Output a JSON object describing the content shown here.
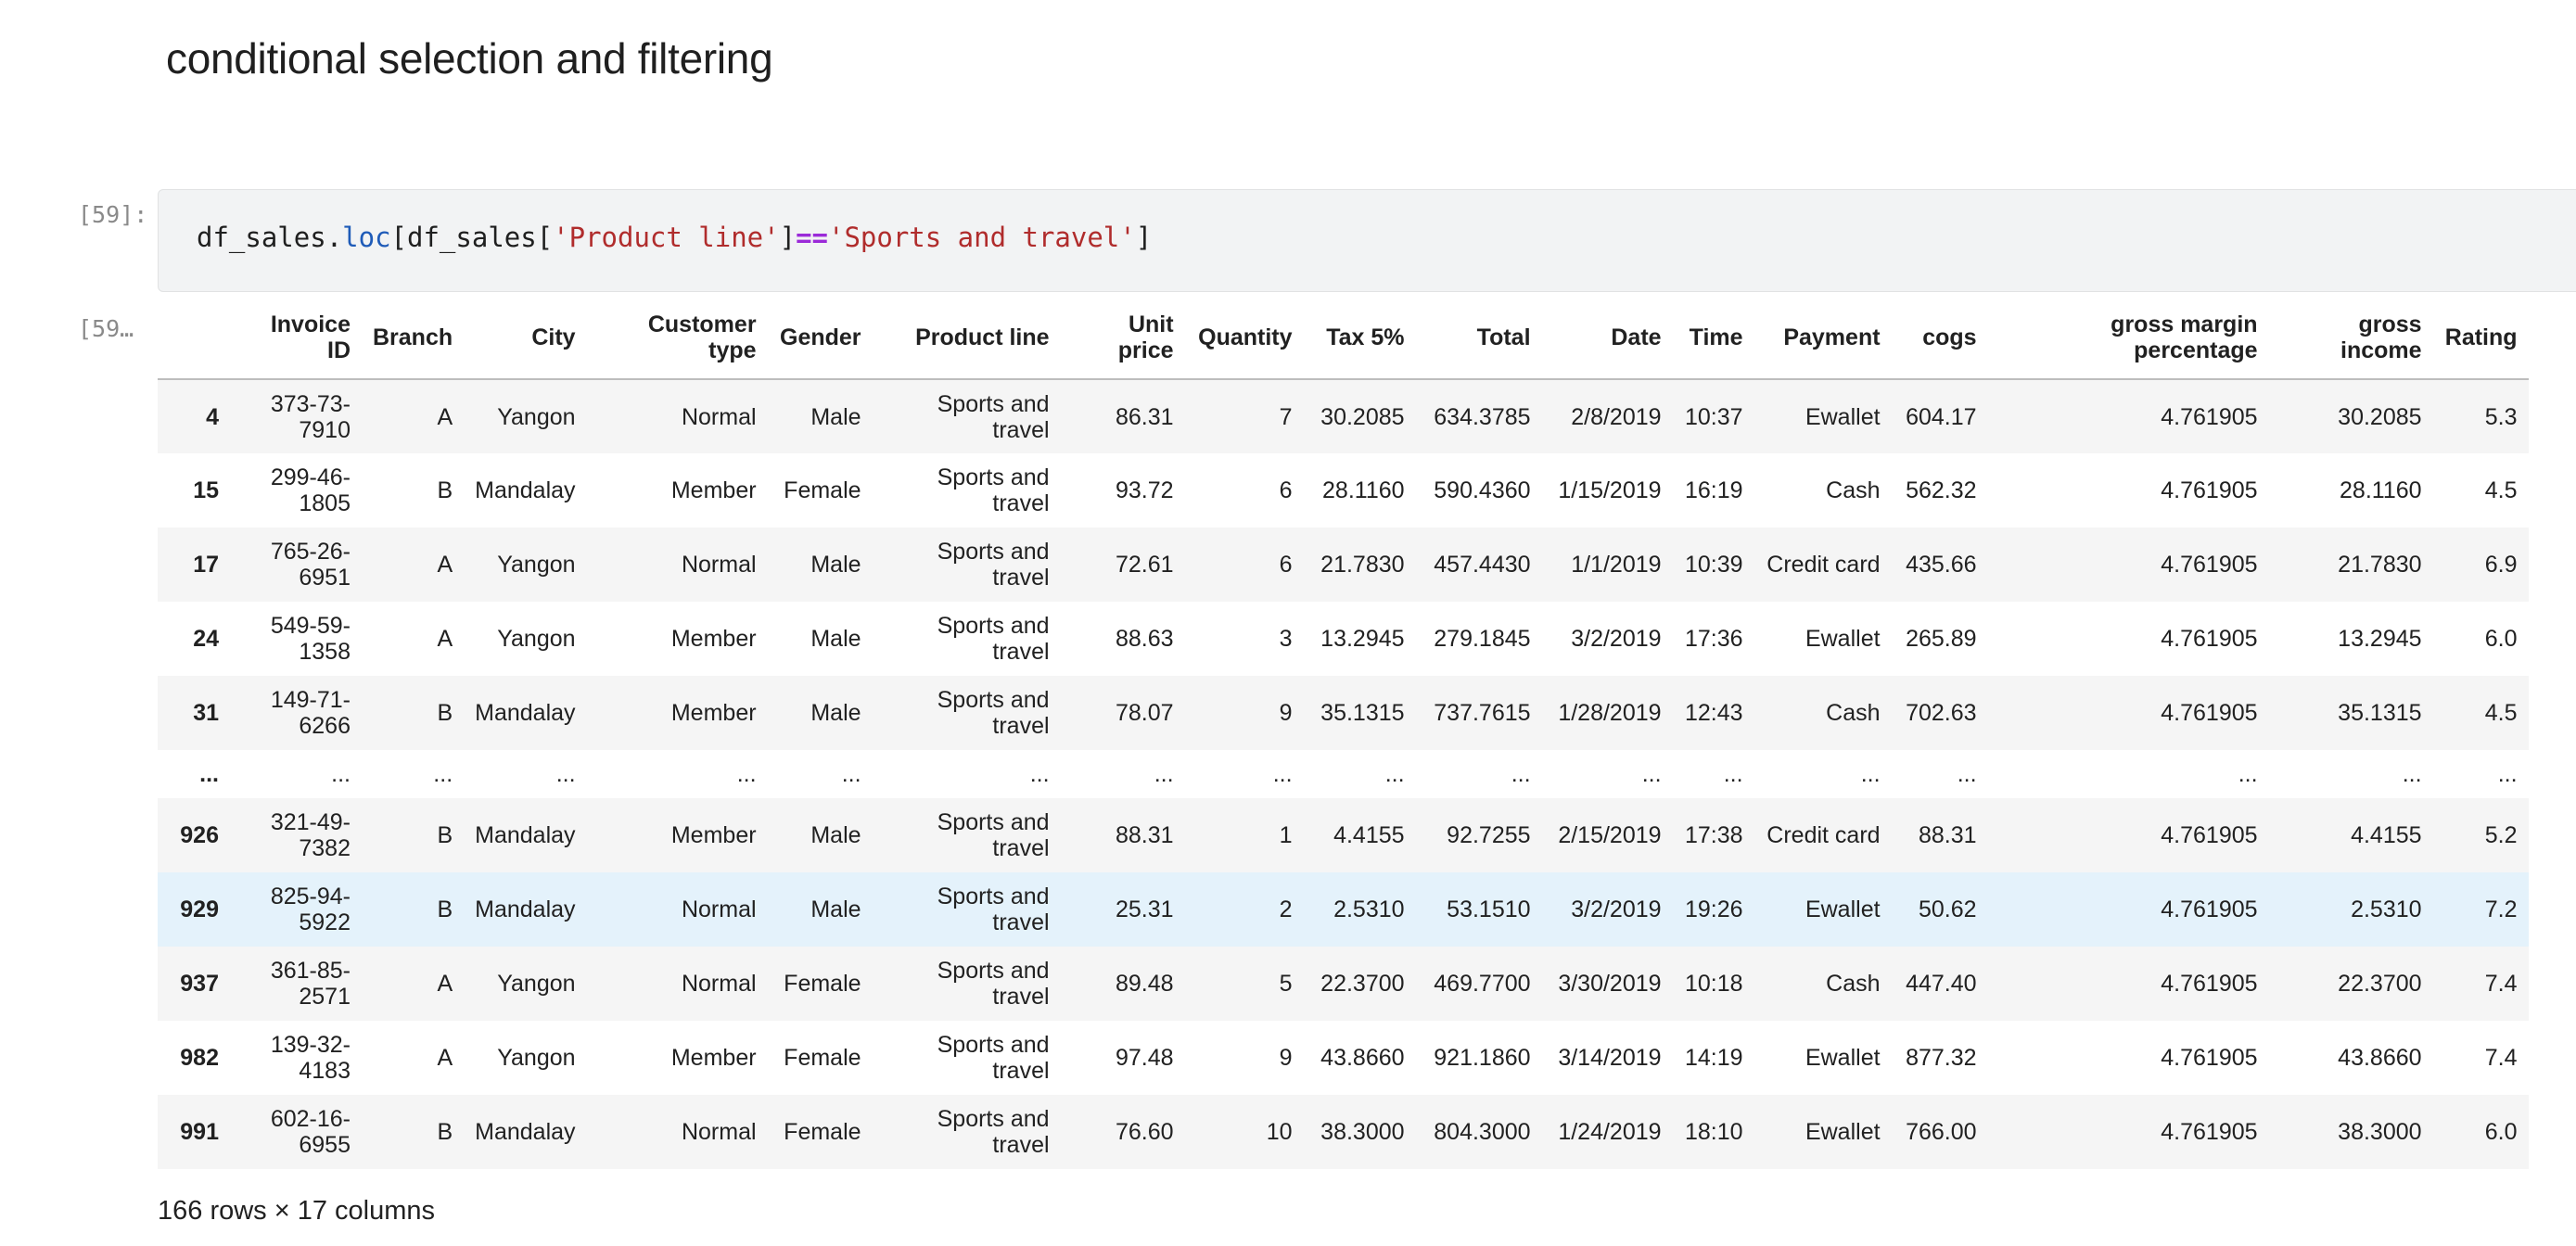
{
  "heading": "conditional selection and filtering",
  "cell": {
    "in_prompt": "[59]:",
    "out_prompt": "[59…",
    "code": {
      "var1": "df_sales",
      "dot": ".",
      "attr": "loc",
      "open1": "[",
      "var2": "df_sales",
      "open2": "[",
      "str1": "'Product line'",
      "close2": "]",
      "op": "==",
      "str2": "'Sports and travel'",
      "close1": "]"
    }
  },
  "table": {
    "columns": [
      "",
      "Invoice ID",
      "Branch",
      "City",
      "Customer type",
      "Gender",
      "Product line",
      "Unit price",
      "Quantity",
      "Tax 5%",
      "Total",
      "Date",
      "Time",
      "Payment",
      "cogs",
      "gross margin percentage",
      "gross income",
      "Rating"
    ],
    "rows": [
      [
        "4",
        "373-73-7910",
        "A",
        "Yangon",
        "Normal",
        "Male",
        "Sports and travel",
        "86.31",
        "7",
        "30.2085",
        "634.3785",
        "2/8/2019",
        "10:37",
        "Ewallet",
        "604.17",
        "4.761905",
        "30.2085",
        "5.3"
      ],
      [
        "15",
        "299-46-1805",
        "B",
        "Mandalay",
        "Member",
        "Female",
        "Sports and travel",
        "93.72",
        "6",
        "28.1160",
        "590.4360",
        "1/15/2019",
        "16:19",
        "Cash",
        "562.32",
        "4.761905",
        "28.1160",
        "4.5"
      ],
      [
        "17",
        "765-26-6951",
        "A",
        "Yangon",
        "Normal",
        "Male",
        "Sports and travel",
        "72.61",
        "6",
        "21.7830",
        "457.4430",
        "1/1/2019",
        "10:39",
        "Credit card",
        "435.66",
        "4.761905",
        "21.7830",
        "6.9"
      ],
      [
        "24",
        "549-59-1358",
        "A",
        "Yangon",
        "Member",
        "Male",
        "Sports and travel",
        "88.63",
        "3",
        "13.2945",
        "279.1845",
        "3/2/2019",
        "17:36",
        "Ewallet",
        "265.89",
        "4.761905",
        "13.2945",
        "6.0"
      ],
      [
        "31",
        "149-71-6266",
        "B",
        "Mandalay",
        "Member",
        "Male",
        "Sports and travel",
        "78.07",
        "9",
        "35.1315",
        "737.7615",
        "1/28/2019",
        "12:43",
        "Cash",
        "702.63",
        "4.761905",
        "35.1315",
        "4.5"
      ],
      [
        "...",
        "...",
        "...",
        "...",
        "...",
        "...",
        "...",
        "...",
        "...",
        "...",
        "...",
        "...",
        "...",
        "...",
        "...",
        "...",
        "...",
        "..."
      ],
      [
        "926",
        "321-49-7382",
        "B",
        "Mandalay",
        "Member",
        "Male",
        "Sports and travel",
        "88.31",
        "1",
        "4.4155",
        "92.7255",
        "2/15/2019",
        "17:38",
        "Credit card",
        "88.31",
        "4.761905",
        "4.4155",
        "5.2"
      ],
      [
        "929",
        "825-94-5922",
        "B",
        "Mandalay",
        "Normal",
        "Male",
        "Sports and travel",
        "25.31",
        "2",
        "2.5310",
        "53.1510",
        "3/2/2019",
        "19:26",
        "Ewallet",
        "50.62",
        "4.761905",
        "2.5310",
        "7.2"
      ],
      [
        "937",
        "361-85-2571",
        "A",
        "Yangon",
        "Normal",
        "Female",
        "Sports and travel",
        "89.48",
        "5",
        "22.3700",
        "469.7700",
        "3/30/2019",
        "10:18",
        "Cash",
        "447.40",
        "4.761905",
        "22.3700",
        "7.4"
      ],
      [
        "982",
        "139-32-4183",
        "A",
        "Yangon",
        "Member",
        "Female",
        "Sports and travel",
        "97.48",
        "9",
        "43.8660",
        "921.1860",
        "3/14/2019",
        "14:19",
        "Ewallet",
        "877.32",
        "4.761905",
        "43.8660",
        "7.4"
      ],
      [
        "991",
        "602-16-6955",
        "B",
        "Mandalay",
        "Normal",
        "Female",
        "Sports and travel",
        "76.60",
        "10",
        "38.3000",
        "804.3000",
        "1/24/2019",
        "18:10",
        "Ewallet",
        "766.00",
        "4.761905",
        "38.3000",
        "6.0"
      ]
    ],
    "highlighted_row_index": 7,
    "footer": "166 rows × 17 columns"
  }
}
